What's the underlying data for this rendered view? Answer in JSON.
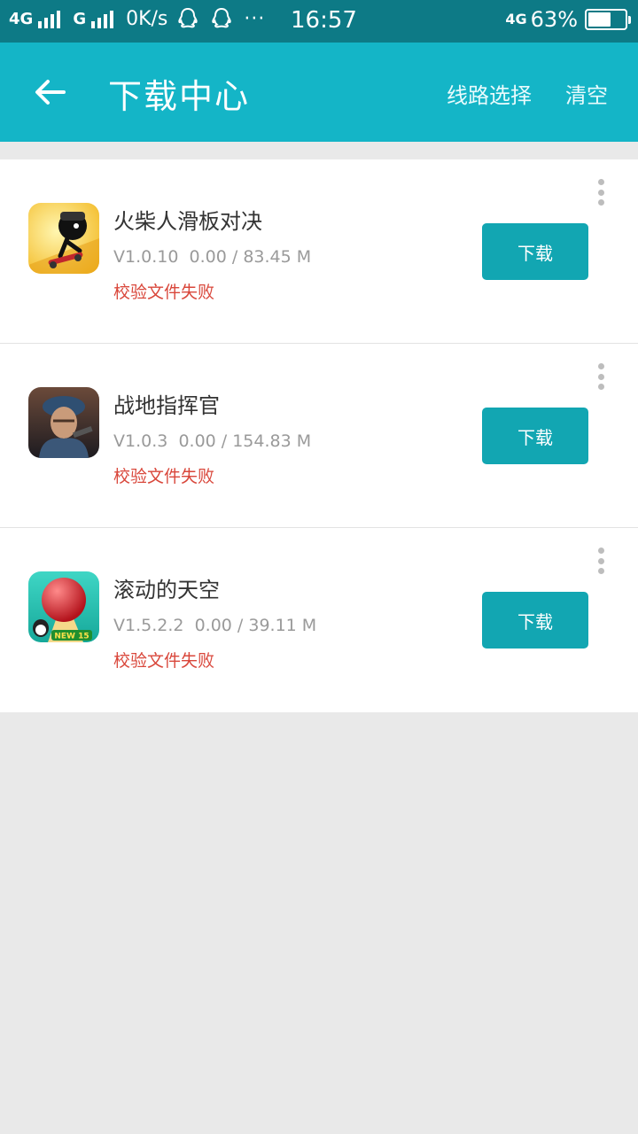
{
  "status_bar": {
    "network_1": "4G",
    "network_2": "G",
    "speed": "0K/s",
    "dots": "···",
    "time": "16:57",
    "network_right": "4G",
    "battery": "63%",
    "battery_level": 0.63
  },
  "header": {
    "title": "下载中心",
    "route_select": "线路选择",
    "clear": "清空"
  },
  "downloads": [
    {
      "name": "火柴人滑板对决",
      "version": "V1.0.10",
      "progress": "0.00 / 83.45 M",
      "status": "校验文件失败",
      "button": "下载",
      "icon": "stickman-skateboard-game-icon"
    },
    {
      "name": "战地指挥官",
      "version": "V1.0.3",
      "progress": "0.00 / 154.83 M",
      "status": "校验文件失败",
      "button": "下载",
      "icon": "soldier-commander-game-icon"
    },
    {
      "name": "滚动的天空",
      "version": "V1.5.2.2",
      "progress": "0.00 / 39.11 M",
      "status": "校验文件失败",
      "button": "下载",
      "icon": "red-ball-game-icon",
      "icon_badge": "NEW 15"
    }
  ],
  "colors": {
    "status_bar": "#0d7a86",
    "header": "#14b5c7",
    "button": "#12a6b2",
    "error": "#d9473b",
    "background": "#e9e9e9"
  }
}
